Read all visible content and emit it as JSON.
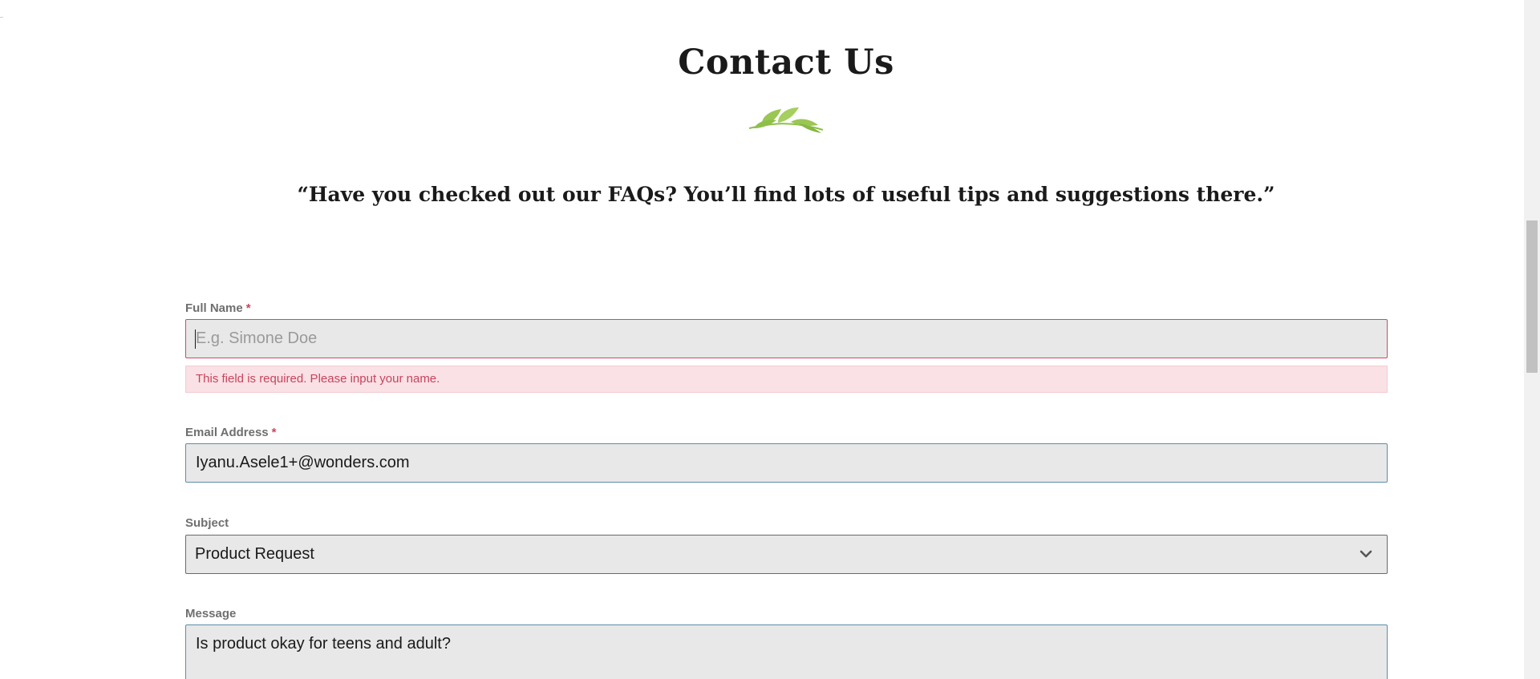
{
  "page": {
    "title": "Contact Us",
    "quote": "“Have you checked out our FAQs? You’ll find lots of useful tips and suggestions there.”"
  },
  "icons": {
    "divider": "leaf-sprig-icon",
    "divider_color": "#8fbf4a",
    "select_chevron": "chevron-down-icon"
  },
  "colors": {
    "error": "#c8445d",
    "error_background": "#f9e1e5",
    "focus_border": "#5a8fa8",
    "field_background": "#e8e8e8"
  },
  "form": {
    "full_name": {
      "label": "Full Name",
      "required_mark": "*",
      "placeholder": "E.g. Simone Doe",
      "value": "",
      "error": "This field is required. Please input your name."
    },
    "email": {
      "label": "Email Address",
      "required_mark": "*",
      "value": "Iyanu.Asele1+@wonders.com"
    },
    "subject": {
      "label": "Subject",
      "value": "Product Request"
    },
    "message": {
      "label": "Message",
      "value": "Is product okay for teens and adult?"
    }
  }
}
